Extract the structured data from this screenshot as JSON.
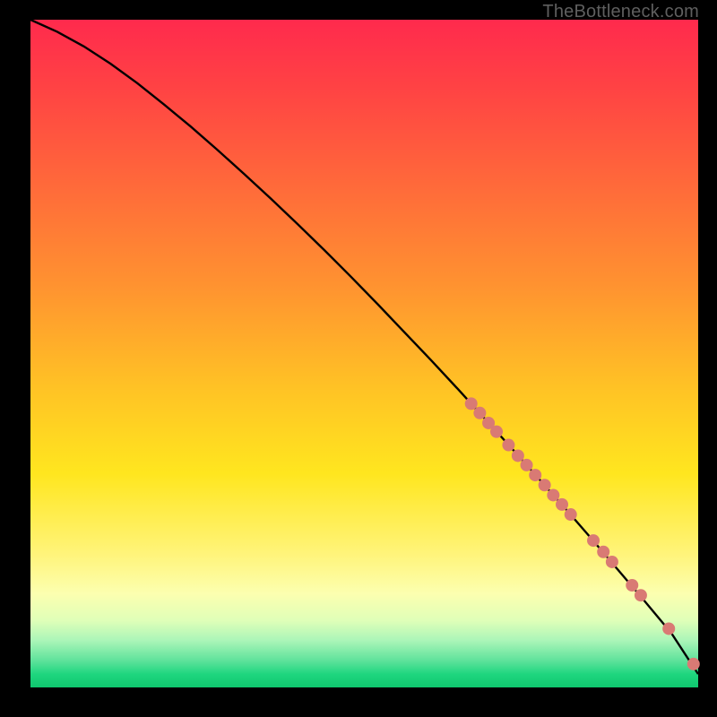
{
  "watermark": {
    "text": "TheBottleneck.com"
  },
  "colors": {
    "line": "#000000",
    "dot_fill": "#d97a74",
    "dot_stroke": "#b85b55"
  },
  "chart_data": {
    "type": "line",
    "title": "",
    "xlabel": "",
    "ylabel": "",
    "xlim": [
      0,
      100
    ],
    "ylim": [
      0,
      100
    ],
    "series": [
      {
        "name": "curve",
        "x": [
          0,
          4,
          8,
          12,
          16,
          20,
          24,
          28,
          32,
          36,
          40,
          44,
          48,
          52,
          56,
          60,
          64,
          68,
          72,
          76,
          80,
          84,
          88,
          92,
          96,
          100
        ],
        "y": [
          100,
          98.2,
          96.0,
          93.4,
          90.5,
          87.3,
          84.0,
          80.5,
          76.9,
          73.2,
          69.4,
          65.5,
          61.5,
          57.4,
          53.2,
          49.0,
          44.7,
          40.3,
          35.9,
          31.4,
          26.9,
          22.3,
          17.6,
          12.9,
          8.1,
          2.0
        ]
      }
    ],
    "points": [
      {
        "x": 66.0,
        "y": 42.5
      },
      {
        "x": 67.3,
        "y": 41.1
      },
      {
        "x": 68.6,
        "y": 39.6
      },
      {
        "x": 69.8,
        "y": 38.3
      },
      {
        "x": 71.6,
        "y": 36.3
      },
      {
        "x": 73.0,
        "y": 34.7
      },
      {
        "x": 74.3,
        "y": 33.3
      },
      {
        "x": 75.6,
        "y": 31.8
      },
      {
        "x": 77.0,
        "y": 30.3
      },
      {
        "x": 78.3,
        "y": 28.8
      },
      {
        "x": 79.6,
        "y": 27.4
      },
      {
        "x": 80.9,
        "y": 25.9
      },
      {
        "x": 84.3,
        "y": 22.0
      },
      {
        "x": 85.8,
        "y": 20.3
      },
      {
        "x": 87.1,
        "y": 18.8
      },
      {
        "x": 90.1,
        "y": 15.3
      },
      {
        "x": 91.4,
        "y": 13.8
      },
      {
        "x": 95.6,
        "y": 8.8
      },
      {
        "x": 99.3,
        "y": 3.5
      }
    ],
    "dot_radius": 7
  }
}
